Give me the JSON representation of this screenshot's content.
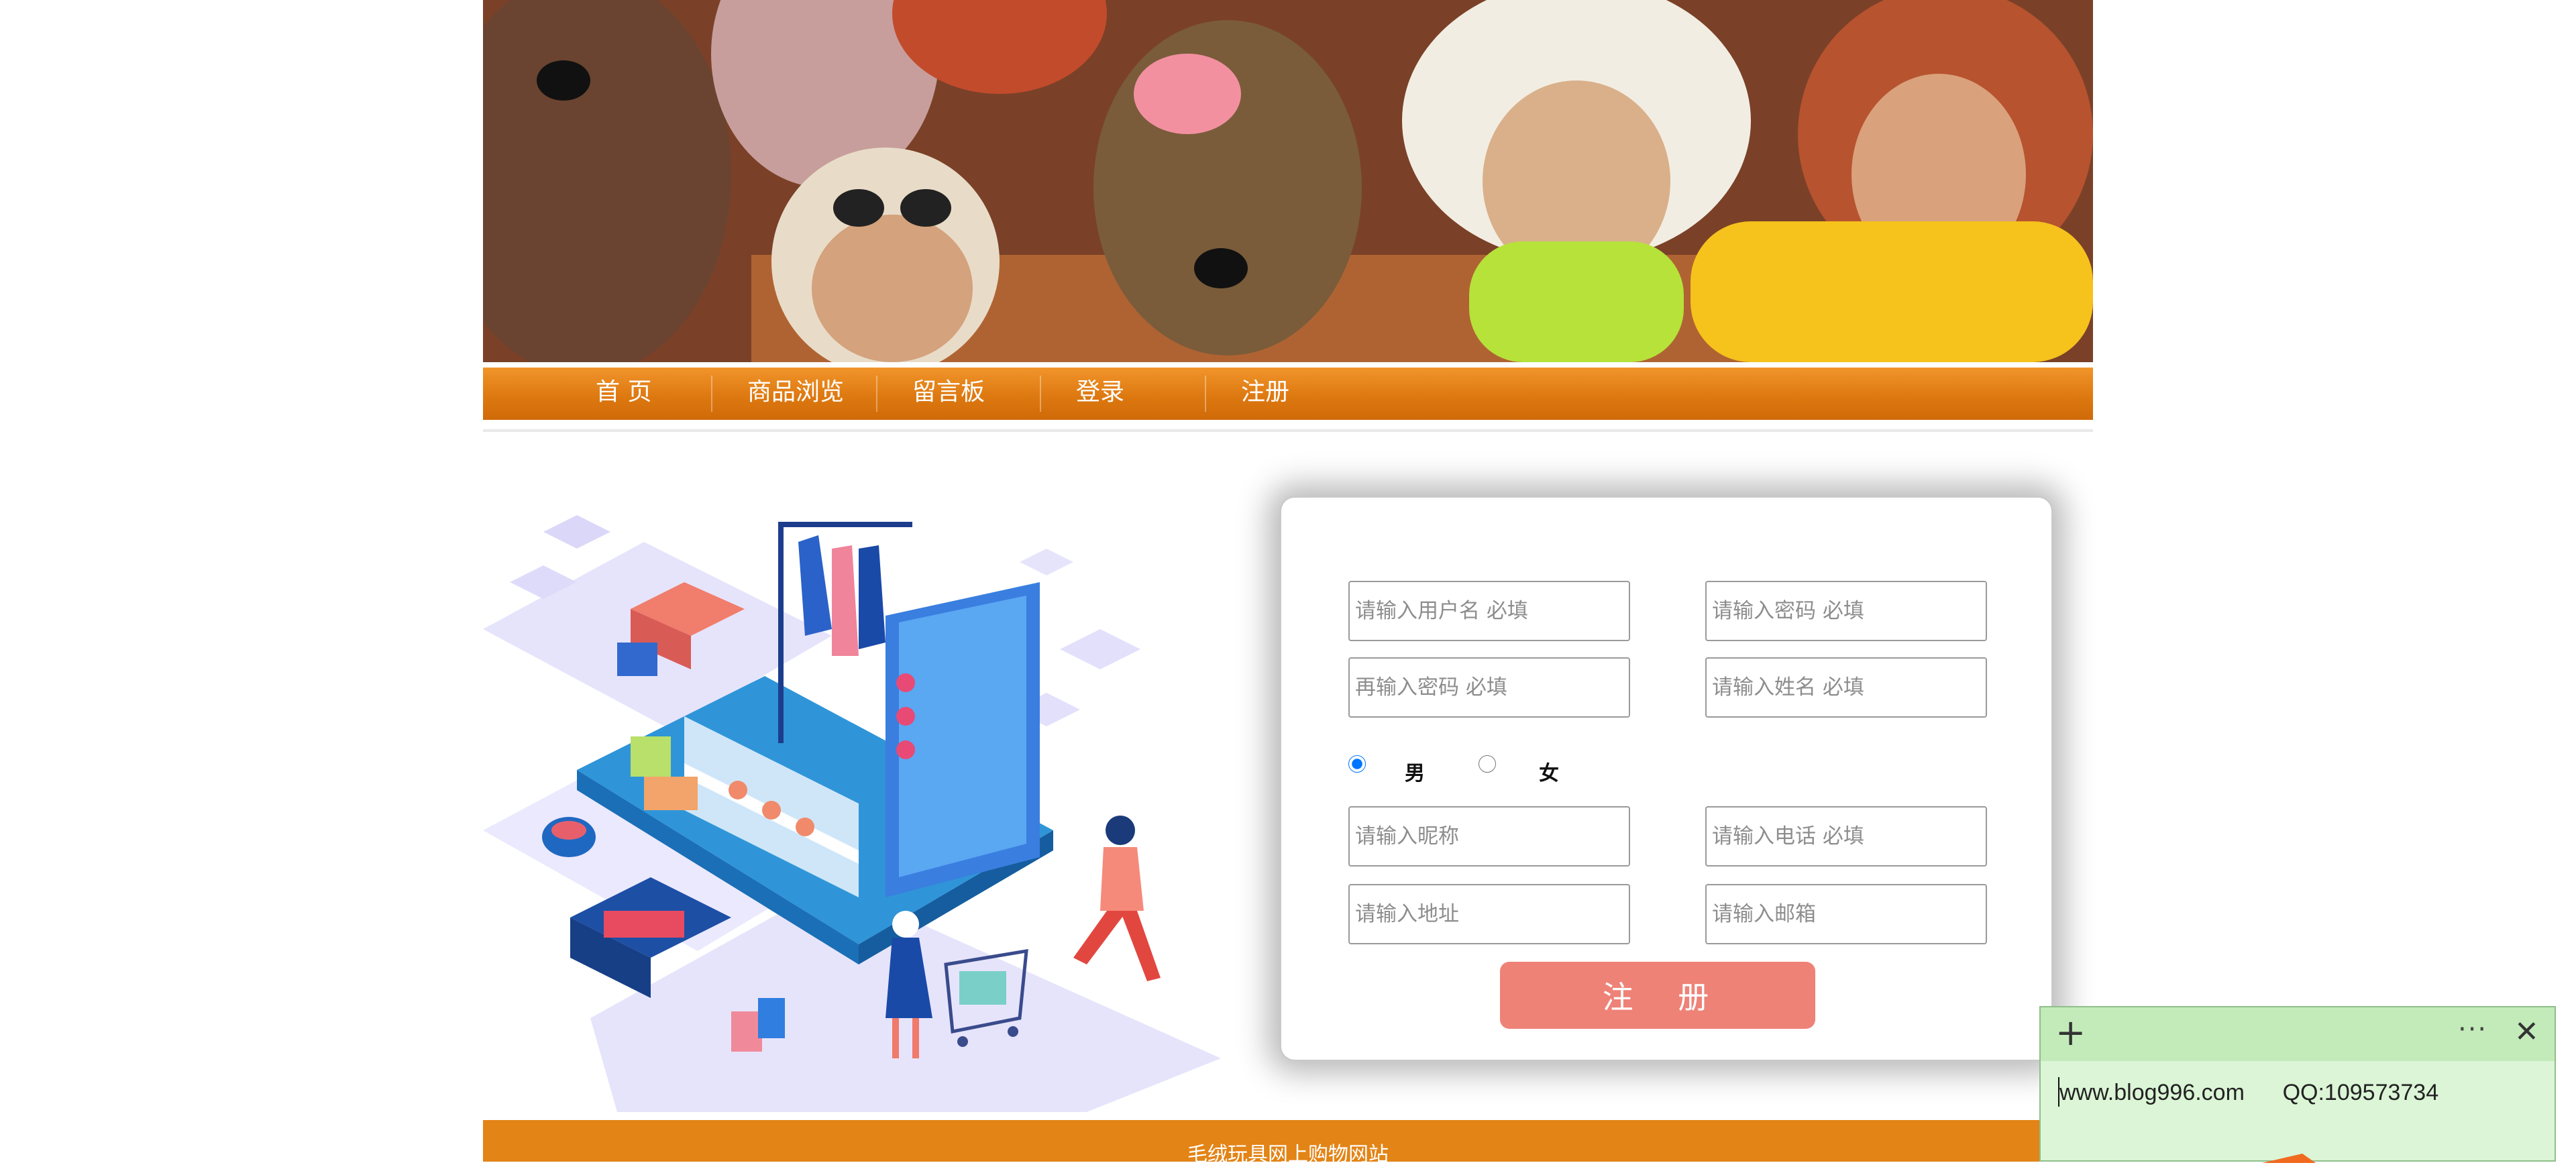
{
  "nav": {
    "items": [
      {
        "label": "首 页"
      },
      {
        "label": "商品浏览"
      },
      {
        "label": "留言板"
      },
      {
        "label": "登录"
      },
      {
        "label": "注册"
      }
    ]
  },
  "form": {
    "username_placeholder": "请输入用户名 必填",
    "password_placeholder": "请输入密码 必填",
    "confirm_password_placeholder": "再输入密码 必填",
    "realname_placeholder": "请输入姓名 必填",
    "gender": {
      "male_label": "男",
      "female_label": "女",
      "selected": "男"
    },
    "nickname_placeholder": "请输入昵称",
    "phone_placeholder": "请输入电话 必填",
    "address_placeholder": "请输入地址",
    "email_placeholder": "请输入邮箱",
    "submit_label": "注 册"
  },
  "footer": {
    "text": "毛绒玩具网上购物网站"
  },
  "sticky_note": {
    "text": "www.blog996.com      QQ:109573734",
    "menu_icon": "more-icon",
    "add_icon": "plus-icon",
    "close_icon": "close-icon"
  },
  "colors": {
    "nav_orange": "#de7911",
    "footer_orange": "#e38416",
    "submit_coral": "#ee8277",
    "note_green": "#dbf5d6"
  }
}
